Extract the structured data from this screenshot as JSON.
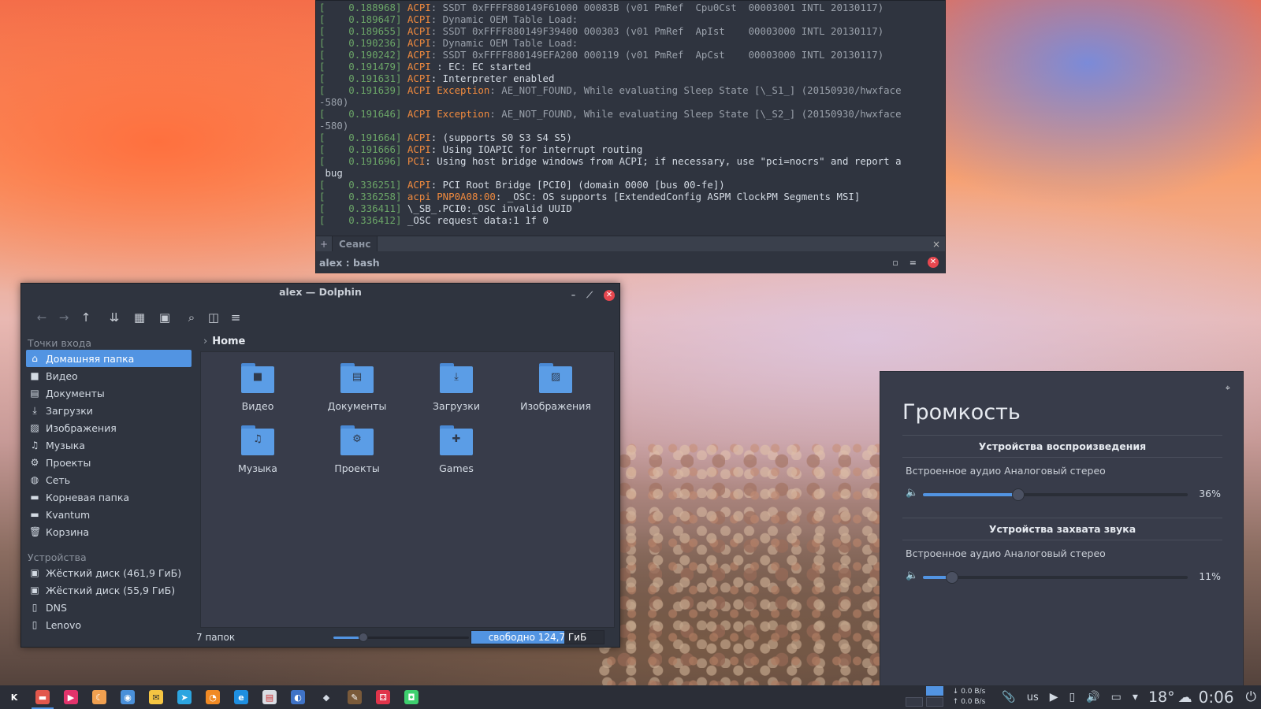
{
  "konsole": {
    "lines": [
      {
        "ts": "[    0.188968] ",
        "tag": "ACPI",
        "tagClass": "a",
        "rest": ": SSDT 0xFFFF880149F61000 00083B (v01 PmRef  Cpu0Cst  00003001 INTL 20130117)",
        "restClass": "m"
      },
      {
        "ts": "[    0.189647] ",
        "tag": "ACPI",
        "tagClass": "a",
        "rest": ": Dynamic OEM Table Load:",
        "restClass": "m"
      },
      {
        "ts": "[    0.189655] ",
        "tag": "ACPI",
        "tagClass": "a",
        "rest": ": SSDT 0xFFFF880149F39400 000303 (v01 PmRef  ApIst    00003000 INTL 20130117)",
        "restClass": "m"
      },
      {
        "ts": "[    0.190236] ",
        "tag": "ACPI",
        "tagClass": "a",
        "rest": ": Dynamic OEM Table Load:",
        "restClass": "m"
      },
      {
        "ts": "[    0.190242] ",
        "tag": "ACPI",
        "tagClass": "a",
        "rest": ": SSDT 0xFFFF880149EFA200 000119 (v01 PmRef  ApCst    00003000 INTL 20130117)",
        "restClass": "m"
      },
      {
        "ts": "[    0.191479] ",
        "tag": "ACPI",
        "tagClass": "a",
        "rest": " : EC: EC started",
        "restClass": "w"
      },
      {
        "ts": "[    0.191631] ",
        "tag": "ACPI",
        "tagClass": "a",
        "rest": ": Interpreter enabled",
        "restClass": "w"
      },
      {
        "ts": "[    0.191639] ",
        "tag": "ACPI Exception",
        "tagClass": "a",
        "rest": ": AE_NOT_FOUND, While evaluating Sleep State [\\_S1_] (20150930/hwxface",
        "restClass": "m"
      },
      {
        "ts": "",
        "tag": "",
        "tagClass": "a",
        "rest": "-580)",
        "restClass": "m"
      },
      {
        "ts": "[    0.191646] ",
        "tag": "ACPI Exception",
        "tagClass": "a",
        "rest": ": AE_NOT_FOUND, While evaluating Sleep State [\\_S2_] (20150930/hwxface",
        "restClass": "m"
      },
      {
        "ts": "",
        "tag": "",
        "tagClass": "a",
        "rest": "-580)",
        "restClass": "m"
      },
      {
        "ts": "[    0.191664] ",
        "tag": "ACPI",
        "tagClass": "a",
        "rest": ": (supports S0 S3 S4 S5)",
        "restClass": "w"
      },
      {
        "ts": "[    0.191666] ",
        "tag": "ACPI",
        "tagClass": "a",
        "rest": ": Using IOAPIC for interrupt routing",
        "restClass": "w"
      },
      {
        "ts": "[    0.191696] ",
        "tag": "PCI",
        "tagClass": "a",
        "rest": ": Using host bridge windows from ACPI; if necessary, use \"pci=nocrs\" and report a",
        "restClass": "w"
      },
      {
        "ts": "",
        "tag": "",
        "tagClass": "a",
        "rest": " bug",
        "restClass": "w"
      },
      {
        "ts": "[    0.336251] ",
        "tag": "ACPI",
        "tagClass": "a",
        "rest": ": PCI Root Bridge [PCI0] (domain 0000 [bus 00-fe])",
        "restClass": "w"
      },
      {
        "ts": "[    0.336258] ",
        "tag": "acpi PNP0A08:00",
        "tagClass": "a",
        "rest": ": _OSC: OS supports [ExtendedConfig ASPM ClockPM Segments MSI]",
        "restClass": "w"
      },
      {
        "ts": "[    0.336411] ",
        "tag": "",
        "tagClass": "a",
        "rest": "\\_SB_.PCI0:_OSC invalid UUID",
        "restClass": "w"
      },
      {
        "ts": "[    0.336412] ",
        "tag": "",
        "tagClass": "a",
        "rest": "_OSC request data:1 1f 0",
        "restClass": "w"
      }
    ],
    "tab_plus": "+",
    "tab_label": "Сеанс",
    "tab_close": "×",
    "title": "alex : bash",
    "btn_restore": "▫",
    "btn_menu": "=",
    "btn_close": "✕"
  },
  "dolphin": {
    "title": "alex — Dolphin",
    "btn_min": "–",
    "btn_max": "⟋",
    "btn_close": "✕",
    "toolbar": {
      "back": "←",
      "forward": "→",
      "up": "↑",
      "sort": "⇊",
      "icons_view": "▦",
      "preview": "▣",
      "search": "⌕",
      "split": "◫",
      "menu": "≡"
    },
    "places_header": "Точки входа",
    "places": [
      {
        "icon": "⌂",
        "label": "Домашняя папка",
        "selected": true
      },
      {
        "icon": "■",
        "label": "Видео"
      },
      {
        "icon": "▤",
        "label": "Документы"
      },
      {
        "icon": "⤓",
        "label": "Загрузки"
      },
      {
        "icon": "▨",
        "label": "Изображения"
      },
      {
        "icon": "♫",
        "label": "Музыка"
      },
      {
        "icon": "⚙",
        "label": "Проекты"
      },
      {
        "icon": "◍",
        "label": "Сеть"
      },
      {
        "icon": "▬",
        "label": "Корневая папка"
      },
      {
        "icon": "▬",
        "label": "Kvantum"
      },
      {
        "icon": "🗑",
        "label": "Корзина"
      }
    ],
    "devices_header": "Устройства",
    "devices": [
      {
        "icon": "▣",
        "label": "Жёсткий диск (461,9 ГиБ)"
      },
      {
        "icon": "▣",
        "label": "Жёсткий диск (55,9 ГиБ)"
      },
      {
        "icon": "▯",
        "label": "DNS"
      },
      {
        "icon": "▯",
        "label": "Lenovo"
      }
    ],
    "breadcrumb_chevron": "›",
    "breadcrumb": "Home",
    "folders": [
      {
        "label": "Видео",
        "emblem": "■"
      },
      {
        "label": "Документы",
        "emblem": "▤"
      },
      {
        "label": "Загрузки",
        "emblem": "⤓"
      },
      {
        "label": "Изображения",
        "emblem": "▨"
      },
      {
        "label": "Музыка",
        "emblem": "♫"
      },
      {
        "label": "Проекты",
        "emblem": "⚙"
      },
      {
        "label": "Games",
        "emblem": "✚"
      }
    ],
    "status_count": "7 папок",
    "zoom_level": 0.22,
    "free_space": "свободно 124,7 ГиБ",
    "free_fraction": 0.7
  },
  "volume": {
    "pin": "⌖",
    "title": "Громкость",
    "playback_header": "Устройства воспроизведения",
    "playback_device": "Встроенное аудио Аналоговый стерео",
    "playback_value": 36,
    "playback_pct": "36%",
    "capture_header": "Устройства захвата звука",
    "capture_device": "Встроенное аудио Аналоговый стерео",
    "capture_value": 11,
    "capture_pct": "11%",
    "speaker_icon": "🔈"
  },
  "taskbar": {
    "apps": [
      {
        "name": "launcher-icon",
        "glyph": "K",
        "bg": "#2b2e37",
        "fg": "#ffffff"
      },
      {
        "name": "dolphin-icon",
        "glyph": "▬",
        "bg": "#e2574c",
        "fg": "#ffffff",
        "active": true
      },
      {
        "name": "player-icon",
        "glyph": "▶",
        "bg": "#e2336b",
        "fg": "#ffffff"
      },
      {
        "name": "weather-moon-icon",
        "glyph": "☾",
        "bg": "#f0a050",
        "fg": "#ffffff"
      },
      {
        "name": "chromium-icon",
        "glyph": "◉",
        "bg": "#4a90d9",
        "fg": "#ffffff"
      },
      {
        "name": "mail-icon",
        "glyph": "✉",
        "bg": "#f5c542",
        "fg": "#333333"
      },
      {
        "name": "telegram-icon",
        "glyph": "➤",
        "bg": "#2ca5e0",
        "fg": "#ffffff"
      },
      {
        "name": "rss-icon",
        "glyph": "◔",
        "bg": "#f08a24",
        "fg": "#ffffff"
      },
      {
        "name": "browser-icon",
        "glyph": "e",
        "bg": "#1f8fe0",
        "fg": "#ffffff"
      },
      {
        "name": "notes-icon",
        "glyph": "▤",
        "bg": "#d9dde3",
        "fg": "#c33"
      },
      {
        "name": "globe-icon",
        "glyph": "◐",
        "bg": "#3f73c7",
        "fg": "#ffffff"
      },
      {
        "name": "inkscape-icon",
        "glyph": "◆",
        "bg": "#2b2e37",
        "fg": "#d3dae3"
      },
      {
        "name": "krita-icon",
        "glyph": "✎",
        "bg": "#7a5a3a",
        "fg": "#ffffff"
      },
      {
        "name": "dice-icon",
        "glyph": "⚃",
        "bg": "#e0344a",
        "fg": "#ffffff"
      },
      {
        "name": "android-icon",
        "glyph": "◘",
        "bg": "#3ecf6e",
        "fg": "#ffffff"
      }
    ],
    "net_down": "0.0 B/s",
    "net_up": "0.0 B/s",
    "clip_icon": "📎",
    "layout": "us",
    "media_icon": "▶",
    "kdeconnect_icon": "▯",
    "volume_icon": "🔊",
    "display_icon": "▭",
    "arrow_icon": "▾",
    "temperature": "18°",
    "weather_icon": "☁",
    "time": "0:06",
    "power_icon": "⏻"
  }
}
